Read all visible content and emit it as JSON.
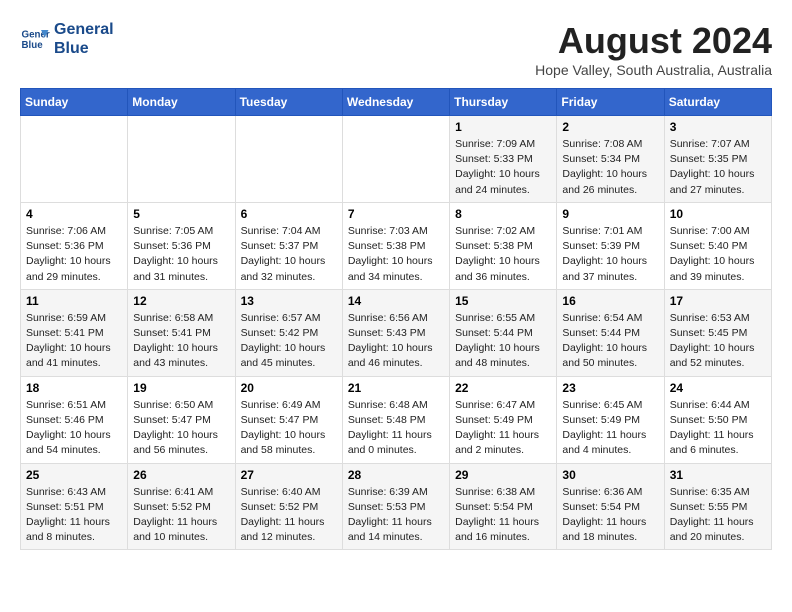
{
  "header": {
    "logo_line1": "General",
    "logo_line2": "Blue",
    "month_year": "August 2024",
    "location": "Hope Valley, South Australia, Australia"
  },
  "weekdays": [
    "Sunday",
    "Monday",
    "Tuesday",
    "Wednesday",
    "Thursday",
    "Friday",
    "Saturday"
  ],
  "weeks": [
    [
      {
        "day": "",
        "content": ""
      },
      {
        "day": "",
        "content": ""
      },
      {
        "day": "",
        "content": ""
      },
      {
        "day": "",
        "content": ""
      },
      {
        "day": "1",
        "content": "Sunrise: 7:09 AM\nSunset: 5:33 PM\nDaylight: 10 hours\nand 24 minutes."
      },
      {
        "day": "2",
        "content": "Sunrise: 7:08 AM\nSunset: 5:34 PM\nDaylight: 10 hours\nand 26 minutes."
      },
      {
        "day": "3",
        "content": "Sunrise: 7:07 AM\nSunset: 5:35 PM\nDaylight: 10 hours\nand 27 minutes."
      }
    ],
    [
      {
        "day": "4",
        "content": "Sunrise: 7:06 AM\nSunset: 5:36 PM\nDaylight: 10 hours\nand 29 minutes."
      },
      {
        "day": "5",
        "content": "Sunrise: 7:05 AM\nSunset: 5:36 PM\nDaylight: 10 hours\nand 31 minutes."
      },
      {
        "day": "6",
        "content": "Sunrise: 7:04 AM\nSunset: 5:37 PM\nDaylight: 10 hours\nand 32 minutes."
      },
      {
        "day": "7",
        "content": "Sunrise: 7:03 AM\nSunset: 5:38 PM\nDaylight: 10 hours\nand 34 minutes."
      },
      {
        "day": "8",
        "content": "Sunrise: 7:02 AM\nSunset: 5:38 PM\nDaylight: 10 hours\nand 36 minutes."
      },
      {
        "day": "9",
        "content": "Sunrise: 7:01 AM\nSunset: 5:39 PM\nDaylight: 10 hours\nand 37 minutes."
      },
      {
        "day": "10",
        "content": "Sunrise: 7:00 AM\nSunset: 5:40 PM\nDaylight: 10 hours\nand 39 minutes."
      }
    ],
    [
      {
        "day": "11",
        "content": "Sunrise: 6:59 AM\nSunset: 5:41 PM\nDaylight: 10 hours\nand 41 minutes."
      },
      {
        "day": "12",
        "content": "Sunrise: 6:58 AM\nSunset: 5:41 PM\nDaylight: 10 hours\nand 43 minutes."
      },
      {
        "day": "13",
        "content": "Sunrise: 6:57 AM\nSunset: 5:42 PM\nDaylight: 10 hours\nand 45 minutes."
      },
      {
        "day": "14",
        "content": "Sunrise: 6:56 AM\nSunset: 5:43 PM\nDaylight: 10 hours\nand 46 minutes."
      },
      {
        "day": "15",
        "content": "Sunrise: 6:55 AM\nSunset: 5:44 PM\nDaylight: 10 hours\nand 48 minutes."
      },
      {
        "day": "16",
        "content": "Sunrise: 6:54 AM\nSunset: 5:44 PM\nDaylight: 10 hours\nand 50 minutes."
      },
      {
        "day": "17",
        "content": "Sunrise: 6:53 AM\nSunset: 5:45 PM\nDaylight: 10 hours\nand 52 minutes."
      }
    ],
    [
      {
        "day": "18",
        "content": "Sunrise: 6:51 AM\nSunset: 5:46 PM\nDaylight: 10 hours\nand 54 minutes."
      },
      {
        "day": "19",
        "content": "Sunrise: 6:50 AM\nSunset: 5:47 PM\nDaylight: 10 hours\nand 56 minutes."
      },
      {
        "day": "20",
        "content": "Sunrise: 6:49 AM\nSunset: 5:47 PM\nDaylight: 10 hours\nand 58 minutes."
      },
      {
        "day": "21",
        "content": "Sunrise: 6:48 AM\nSunset: 5:48 PM\nDaylight: 11 hours\nand 0 minutes."
      },
      {
        "day": "22",
        "content": "Sunrise: 6:47 AM\nSunset: 5:49 PM\nDaylight: 11 hours\nand 2 minutes."
      },
      {
        "day": "23",
        "content": "Sunrise: 6:45 AM\nSunset: 5:49 PM\nDaylight: 11 hours\nand 4 minutes."
      },
      {
        "day": "24",
        "content": "Sunrise: 6:44 AM\nSunset: 5:50 PM\nDaylight: 11 hours\nand 6 minutes."
      }
    ],
    [
      {
        "day": "25",
        "content": "Sunrise: 6:43 AM\nSunset: 5:51 PM\nDaylight: 11 hours\nand 8 minutes."
      },
      {
        "day": "26",
        "content": "Sunrise: 6:41 AM\nSunset: 5:52 PM\nDaylight: 11 hours\nand 10 minutes."
      },
      {
        "day": "27",
        "content": "Sunrise: 6:40 AM\nSunset: 5:52 PM\nDaylight: 11 hours\nand 12 minutes."
      },
      {
        "day": "28",
        "content": "Sunrise: 6:39 AM\nSunset: 5:53 PM\nDaylight: 11 hours\nand 14 minutes."
      },
      {
        "day": "29",
        "content": "Sunrise: 6:38 AM\nSunset: 5:54 PM\nDaylight: 11 hours\nand 16 minutes."
      },
      {
        "day": "30",
        "content": "Sunrise: 6:36 AM\nSunset: 5:54 PM\nDaylight: 11 hours\nand 18 minutes."
      },
      {
        "day": "31",
        "content": "Sunrise: 6:35 AM\nSunset: 5:55 PM\nDaylight: 11 hours\nand 20 minutes."
      }
    ]
  ]
}
